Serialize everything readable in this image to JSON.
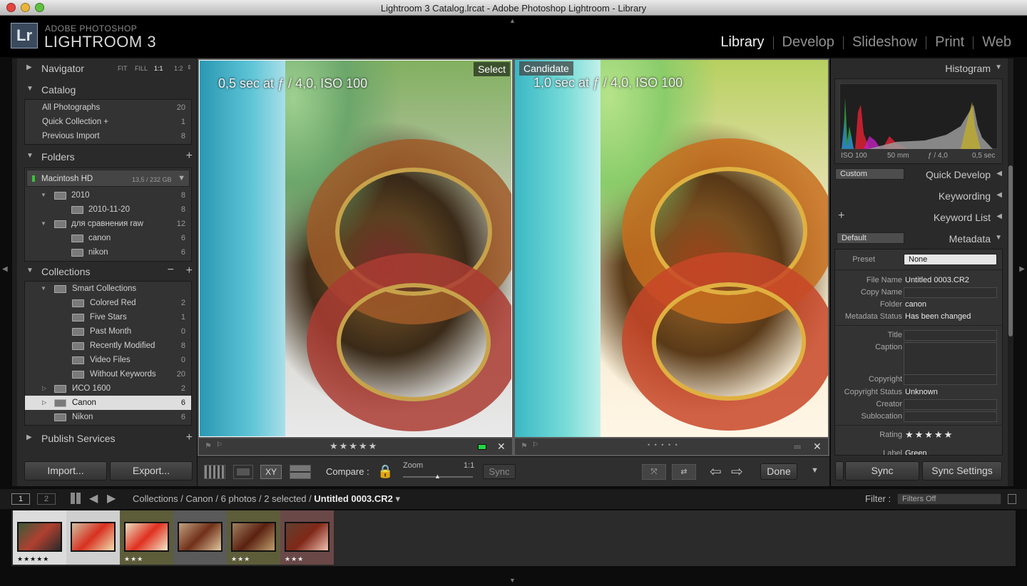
{
  "window": {
    "title": "Lightroom 3 Catalog.lrcat - Adobe Photoshop Lightroom - Library"
  },
  "brand": {
    "logo_text": "Lr",
    "line1": "ADOBE PHOTOSHOP",
    "line2": "LIGHTROOM 3"
  },
  "modules": [
    "Library",
    "Develop",
    "Slideshow",
    "Print",
    "Web"
  ],
  "navigator": {
    "title": "Navigator",
    "zoom_opts": [
      "FIT",
      "FILL",
      "1:1",
      "1:2"
    ]
  },
  "catalog": {
    "title": "Catalog",
    "items": [
      {
        "label": "All Photographs",
        "count": "20"
      },
      {
        "label": "Quick Collection  +",
        "count": "1"
      },
      {
        "label": "Previous Import",
        "count": "8"
      }
    ]
  },
  "folders": {
    "title": "Folders",
    "volume": {
      "label": "Macintosh HD",
      "size": "13,5 / 232 GB"
    },
    "items": [
      {
        "label": "2010",
        "count": "8",
        "level": 1
      },
      {
        "label": "2010-11-20",
        "count": "8",
        "level": 2
      },
      {
        "label": "для сравнения raw",
        "count": "12",
        "level": 1
      },
      {
        "label": "canon",
        "count": "6",
        "level": 2
      },
      {
        "label": "nikon",
        "count": "6",
        "level": 2
      }
    ]
  },
  "collections": {
    "title": "Collections",
    "items": [
      {
        "label": "Smart Collections",
        "count": "",
        "level": 1,
        "selected": false
      },
      {
        "label": "Colored Red",
        "count": "2",
        "level": 2,
        "selected": false
      },
      {
        "label": "Five Stars",
        "count": "1",
        "level": 2,
        "selected": false
      },
      {
        "label": "Past Month",
        "count": "0",
        "level": 2,
        "selected": false
      },
      {
        "label": "Recently Modified",
        "count": "8",
        "level": 2,
        "selected": false
      },
      {
        "label": "Video Files",
        "count": "0",
        "level": 2,
        "selected": false
      },
      {
        "label": "Without Keywords",
        "count": "20",
        "level": 2,
        "selected": false
      },
      {
        "label": "ИСО 1600",
        "count": "2",
        "level": 1,
        "selected": false
      },
      {
        "label": "Canon",
        "count": "6",
        "level": 1,
        "selected": true
      },
      {
        "label": "Nikon",
        "count": "6",
        "level": 1,
        "selected": false
      }
    ]
  },
  "publish": {
    "title": "Publish Services"
  },
  "left_buttons": {
    "import": "Import...",
    "export": "Export..."
  },
  "compare": {
    "select": {
      "tag": "Select",
      "exif": "0,5 sec at ƒ / 4,0, ISO 100",
      "stars": "★★★★★"
    },
    "candidate": {
      "tag": "Candidate",
      "exif": "1,0 sec at ƒ / 4,0, ISO 100",
      "stars": "• • • • •"
    }
  },
  "toolbar": {
    "compare_label": "Compare :",
    "zoom_label": "Zoom",
    "zoom_value": "1:1",
    "sync": "Sync",
    "done": "Done",
    "xy": "XY"
  },
  "histogram": {
    "title": "Histogram",
    "iso": "ISO 100",
    "focal": "50 mm",
    "aperture": "ƒ / 4,0",
    "shutter": "0,5 sec"
  },
  "quick_develop": {
    "preset": "Custom",
    "title": "Quick Develop"
  },
  "keywording": {
    "title": "Keywording"
  },
  "keyword_list": {
    "title": "Keyword List"
  },
  "metadata": {
    "preset_dropdown": "Default",
    "title": "Metadata",
    "preset_label": "Preset",
    "preset_value": "None",
    "fields": [
      {
        "key": "File Name",
        "value": "Untitled 0003.CR2"
      },
      {
        "key": "Copy Name",
        "value": ""
      },
      {
        "key": "Folder",
        "value": "canon"
      },
      {
        "key": "Metadata Status",
        "value": "Has been changed"
      }
    ],
    "fields2": [
      {
        "key": "Title",
        "value": ""
      },
      {
        "key": "Caption",
        "value": ""
      }
    ],
    "fields3": [
      {
        "key": "Copyright",
        "value": ""
      },
      {
        "key": "Copyright Status",
        "value": "Unknown"
      },
      {
        "key": "Creator",
        "value": ""
      },
      {
        "key": "Sublocation",
        "value": ""
      }
    ],
    "rating_label": "Rating",
    "rating": "★★★★★",
    "label_key": "Label",
    "label_value": "Green"
  },
  "right_buttons": {
    "sync": "Sync",
    "sync_settings": "Sync Settings"
  },
  "filmstrip": {
    "pages": [
      "1",
      "2"
    ],
    "breadcrumb": "Collections / Canon / 6 photos / 2 selected / ",
    "current_file": "Untitled 0003.CR2",
    "filter_label": "Filter :",
    "filter_value": "Filters Off",
    "thumbs": [
      {
        "stars": "★★★★★",
        "bg": "#dcdcdc"
      },
      {
        "stars": "",
        "bg": "#cfcfcf"
      },
      {
        "stars": "★★★",
        "bg": "#5d5d3a"
      },
      {
        "stars": "",
        "bg": "#5a5a5a"
      },
      {
        "stars": "★★★",
        "bg": "#5d5d3a"
      },
      {
        "stars": "★★★",
        "bg": "#6a4848"
      }
    ]
  },
  "colors": {
    "panel": "#2a2a2a",
    "accent_selected": "#e8e8e8",
    "background": "#0c0c0c"
  }
}
